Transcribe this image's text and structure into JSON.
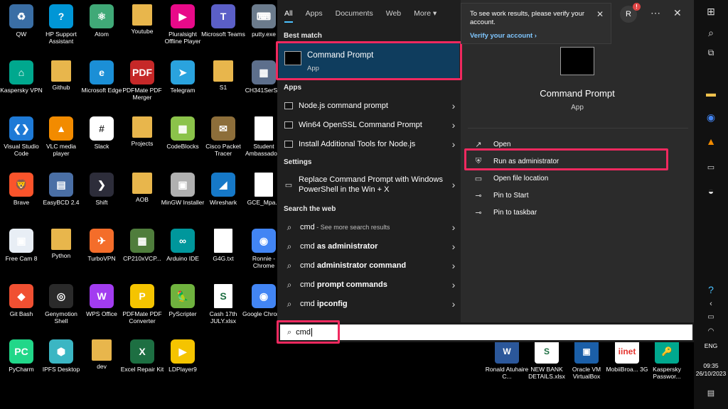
{
  "desktop_icons": [
    {
      "label": "QW",
      "icon": "recycle-bin-icon",
      "color": "#3a6ea5",
      "glyph": "♻"
    },
    {
      "label": "HP Support Assistant",
      "icon": "help-icon",
      "color": "#0096d6",
      "glyph": "?"
    },
    {
      "label": "Atom",
      "icon": "atom-icon",
      "color": "#40a977",
      "glyph": "⚛"
    },
    {
      "label": "Youtube",
      "icon": "folder-icon",
      "color": "#e8b64c",
      "glyph": ""
    },
    {
      "label": "Pluralsight Offline Player",
      "icon": "pluralsight-icon",
      "color": "#e80a89",
      "glyph": "▶"
    },
    {
      "label": "Microsoft Teams",
      "icon": "teams-icon",
      "color": "#5b5fc7",
      "glyph": "T"
    },
    {
      "label": "putty.exe",
      "icon": "putty-icon",
      "color": "#6b7b8c",
      "glyph": "⌨"
    },
    {
      "label": "Kaspersky VPN",
      "icon": "kaspersky-vpn-icon",
      "color": "#00a88e",
      "glyph": "⌂"
    },
    {
      "label": "Github",
      "icon": "folder-icon",
      "color": "#e8b64c",
      "glyph": ""
    },
    {
      "label": "Microsoft Edge",
      "icon": "edge-icon",
      "color": "#1b8fd6",
      "glyph": "e"
    },
    {
      "label": "PDFMate PDF Merger",
      "icon": "pdf-merger-icon",
      "color": "#c62828",
      "glyph": "PDF"
    },
    {
      "label": "Telegram",
      "icon": "telegram-icon",
      "color": "#2aa3de",
      "glyph": "➤"
    },
    {
      "label": "S1",
      "icon": "folder-icon",
      "color": "#e8b64c",
      "glyph": ""
    },
    {
      "label": "CH341SerS...",
      "icon": "installer-icon",
      "color": "#5d6f8c",
      "glyph": "▦"
    },
    {
      "label": "Visual Studio Code",
      "icon": "vscode-icon",
      "color": "#1e7ad6",
      "glyph": "❮❯"
    },
    {
      "label": "VLC media player",
      "icon": "vlc-icon",
      "color": "#f28b00",
      "glyph": "▲"
    },
    {
      "label": "Slack",
      "icon": "slack-icon",
      "color": "#ffffff",
      "glyph": "#"
    },
    {
      "label": "Projects",
      "icon": "folder-icon",
      "color": "#e8b64c",
      "glyph": ""
    },
    {
      "label": "CodeBlocks",
      "icon": "codeblocks-icon",
      "color": "#8bc34a",
      "glyph": "▦"
    },
    {
      "label": "Cisco Packet Tracer",
      "icon": "packet-tracer-icon",
      "color": "#8d6e3a",
      "glyph": "✉"
    },
    {
      "label": "Student Ambassado...",
      "icon": "document-icon",
      "color": "#ffffff",
      "glyph": ""
    },
    {
      "label": "Brave",
      "icon": "brave-icon",
      "color": "#fb542b",
      "glyph": "🦁"
    },
    {
      "label": "EasyBCD 2.4",
      "icon": "easybcd-icon",
      "color": "#4a6fa5",
      "glyph": "▤"
    },
    {
      "label": "Shift",
      "icon": "shift-icon",
      "color": "#2d2d3a",
      "glyph": "❯"
    },
    {
      "label": "AOB",
      "icon": "folder-icon",
      "color": "#e8b64c",
      "glyph": ""
    },
    {
      "label": "MinGW Installer",
      "icon": "mingw-icon",
      "color": "#b0b0b0",
      "glyph": "▣"
    },
    {
      "label": "Wireshark",
      "icon": "wireshark-icon",
      "color": "#1679c8",
      "glyph": "◢"
    },
    {
      "label": "GCE_Mpa...",
      "icon": "document-icon",
      "color": "#ffffff",
      "glyph": ""
    },
    {
      "label": "Free Cam 8",
      "icon": "freecam-icon",
      "color": "#e8eef5",
      "glyph": "▣"
    },
    {
      "label": "Python",
      "icon": "folder-icon",
      "color": "#e8b64c",
      "glyph": ""
    },
    {
      "label": "TurboVPN",
      "icon": "turbovpn-icon",
      "color": "#f46d2a",
      "glyph": "✈"
    },
    {
      "label": "CP210xVCP...",
      "icon": "installer-icon",
      "color": "#4f7d3c",
      "glyph": "▦"
    },
    {
      "label": "Arduino IDE",
      "icon": "arduino-icon",
      "color": "#00979c",
      "glyph": "∞"
    },
    {
      "label": "G4G.txt",
      "icon": "document-icon",
      "color": "#ffffff",
      "glyph": ""
    },
    {
      "label": "Ronnie - Chrome",
      "icon": "chrome-icon",
      "color": "#4285f4",
      "glyph": "◉"
    },
    {
      "label": "Git Bash",
      "icon": "git-bash-icon",
      "color": "#f05032",
      "glyph": "◆"
    },
    {
      "label": "Genymotion Shell",
      "icon": "genymotion-icon",
      "color": "#2a2a2a",
      "glyph": "◎"
    },
    {
      "label": "WPS Office",
      "icon": "wps-icon",
      "color": "#a23cf0",
      "glyph": "W"
    },
    {
      "label": "PDFMate PDF Converter",
      "icon": "pdf-converter-icon",
      "color": "#f5c400",
      "glyph": "P"
    },
    {
      "label": "PyScripter",
      "icon": "pyscripter-icon",
      "color": "#6fb23e",
      "glyph": "🦜"
    },
    {
      "label": "Cash 17th JULY.xlsx",
      "icon": "spreadsheet-icon",
      "color": "#ffffff",
      "glyph": "S"
    },
    {
      "label": "Google Chrome",
      "icon": "chrome-icon",
      "color": "#4285f4",
      "glyph": "◉"
    },
    {
      "label": "PyCharm",
      "icon": "pycharm-icon",
      "color": "#21d789",
      "glyph": "PC"
    },
    {
      "label": "IPFS Desktop",
      "icon": "ipfs-icon",
      "color": "#3bb6c3",
      "glyph": "⬢"
    },
    {
      "label": "dev",
      "icon": "folder-icon",
      "color": "#e8b64c",
      "glyph": ""
    },
    {
      "label": "Excel Repair Kit",
      "icon": "excel-icon",
      "color": "#1d6f42",
      "glyph": "X"
    },
    {
      "label": "LDPlayer9",
      "icon": "ldplayer-icon",
      "color": "#f5c400",
      "glyph": "▶"
    }
  ],
  "desktop_bottom_icons": [
    {
      "label": "Ronald Atuhaire C...",
      "icon": "word-icon",
      "color": "#2b579a",
      "glyph": "W"
    },
    {
      "label": "NEW BANK DETAILS.xlsx",
      "icon": "spreadsheet-icon",
      "color": "#ffffff",
      "glyph": "S"
    },
    {
      "label": "Oracle VM VirtualBox",
      "icon": "virtualbox-icon",
      "color": "#1b5fa8",
      "glyph": "▣"
    },
    {
      "label": "MobiiBroa... 3G",
      "icon": "iinet-icon",
      "color": "#ffffff",
      "glyph": "iinet"
    },
    {
      "label": "Kaspersky Passwor...",
      "icon": "kaspersky-password-icon",
      "color": "#00a88e",
      "glyph": "🔑"
    }
  ],
  "tabs": [
    {
      "label": "All",
      "active": true
    },
    {
      "label": "Apps"
    },
    {
      "label": "Documents"
    },
    {
      "label": "Web"
    },
    {
      "label": "More ▾"
    }
  ],
  "best_match": {
    "section": "Best match",
    "title": "Command Prompt",
    "subtitle": "App"
  },
  "apps": {
    "section": "Apps",
    "items": [
      "Node.js command prompt",
      "Win64 OpenSSL Command Prompt",
      "Install Additional Tools for Node.js"
    ]
  },
  "settings": {
    "section": "Settings",
    "items": [
      "Replace Command Prompt with Windows PowerShell in the Win + X"
    ]
  },
  "web": {
    "section": "Search the web",
    "items": [
      {
        "bold": "cmd",
        "sub": " - See more search results"
      },
      {
        "prefix": "cmd ",
        "bold": "as administrator"
      },
      {
        "prefix": "cmd ",
        "bold": "administrator command"
      },
      {
        "prefix": "cmd ",
        "bold": "prompt commands"
      },
      {
        "prefix": "cmd ",
        "bold": "ipconfig"
      }
    ]
  },
  "preview": {
    "title": "Command Prompt",
    "subtitle": "App",
    "actions": [
      {
        "label": "Open",
        "icon": "open-icon",
        "glyph": "↗"
      },
      {
        "label": "Run as administrator",
        "icon": "shield-icon",
        "glyph": "⛨"
      },
      {
        "label": "Open file location",
        "icon": "folder-location-icon",
        "glyph": "▭"
      },
      {
        "label": "Pin to Start",
        "icon": "pin-icon",
        "glyph": "⊸"
      },
      {
        "label": "Pin to taskbar",
        "icon": "pin-icon",
        "glyph": "⊸"
      }
    ]
  },
  "notice": {
    "text": "To see work results, please verify your account.",
    "link": "Verify your account ›"
  },
  "user": {
    "initial": "R",
    "badge": "!"
  },
  "search": {
    "value": "cmd"
  },
  "taskbar": {
    "language": "ENG",
    "time": "09:35",
    "date": "26/10/2023"
  },
  "colors": {
    "highlight": "#f0295f",
    "selection": "#0f3d5e",
    "accent": "#4cc2ff"
  }
}
